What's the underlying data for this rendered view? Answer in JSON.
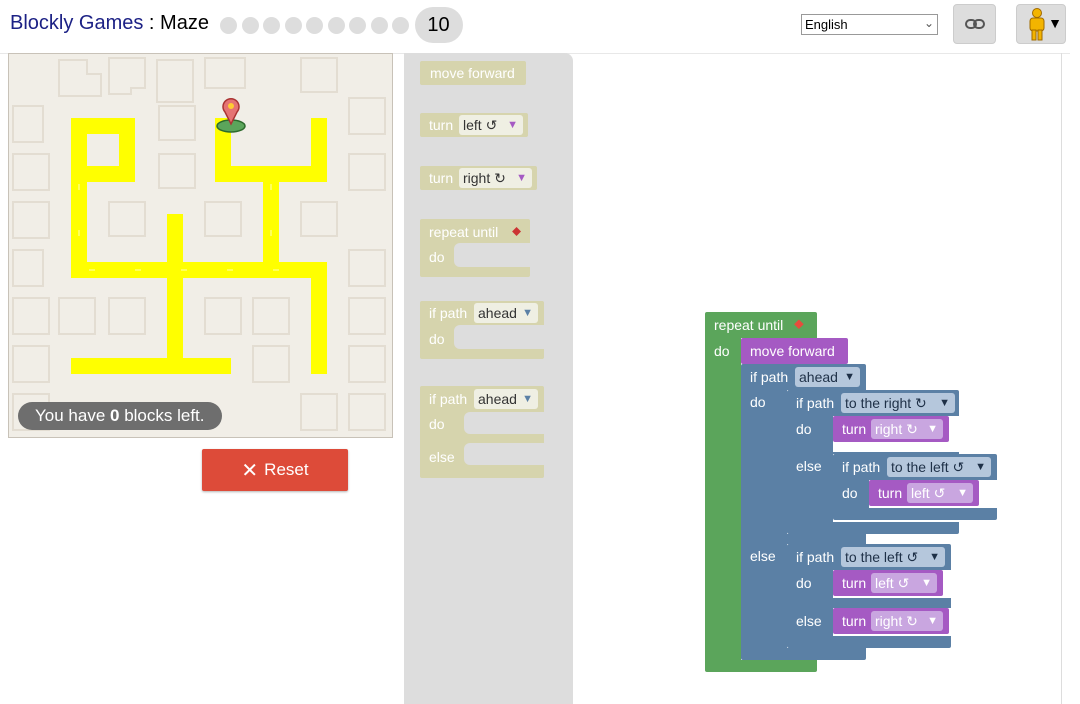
{
  "header": {
    "brand": "Blockly Games",
    "separator": " : ",
    "game": "Maze",
    "current_level": "10",
    "language": "English"
  },
  "icons": {
    "link": "link-icon",
    "pegman": "pegman-icon",
    "reset": "close-icon",
    "start_marker": "map-marker-icon"
  },
  "maze": {
    "blocks_left_prefix": "You have ",
    "blocks_left_count": "0",
    "blocks_left_suffix": " blocks left."
  },
  "reset_label": "Reset",
  "toolbox": {
    "move_forward": "move forward",
    "turn": "turn",
    "left": "left ↺",
    "right": "right ↻",
    "repeat_until": "repeat until",
    "do": "do",
    "if_path": "if path",
    "ahead": "ahead",
    "else": "else"
  },
  "program": {
    "repeat_until": "repeat until",
    "do": "do",
    "move_forward": "move forward",
    "if_path": "if path",
    "ahead": "ahead",
    "else": "else",
    "to_the_right": "to the right ↻",
    "to_the_left": "to the left ↺",
    "turn": "turn",
    "right": "right ↻",
    "left": "left ↺"
  },
  "colors": {
    "movement": "#a55ac3",
    "logic": "#5b80a5",
    "loop": "#5ba55b",
    "flyout_block": "#d6d4ad",
    "path": "#ffff00",
    "reset": "#dd4b39"
  }
}
